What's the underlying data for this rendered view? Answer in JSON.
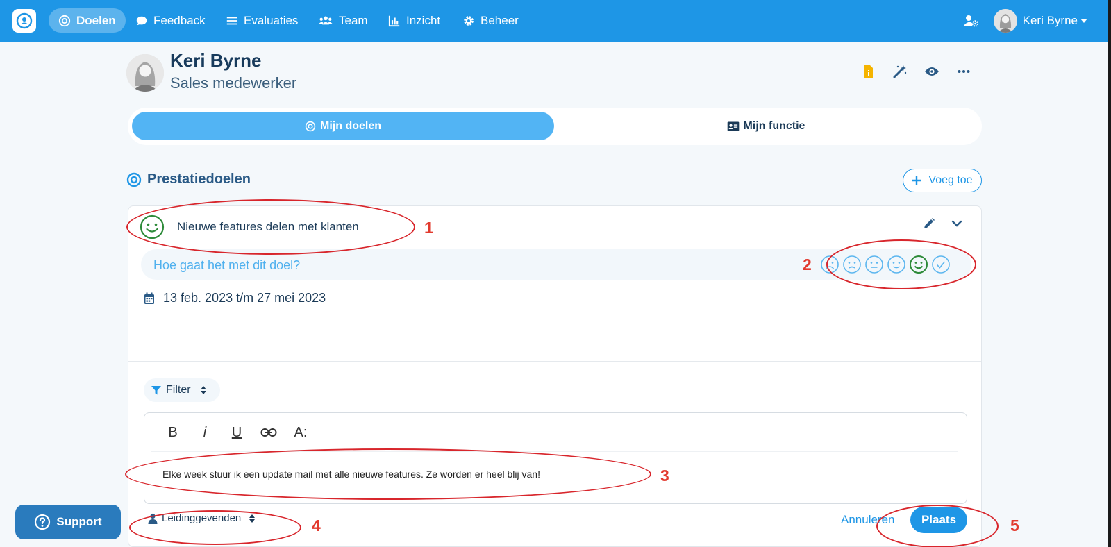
{
  "nav": {
    "items": [
      {
        "label": "Doelen",
        "icon": "target-icon",
        "active": true
      },
      {
        "label": "Feedback",
        "icon": "chat-icon"
      },
      {
        "label": "Evaluaties",
        "icon": "list-icon"
      },
      {
        "label": "Team",
        "icon": "users-icon"
      },
      {
        "label": "Inzicht",
        "icon": "chart-icon"
      },
      {
        "label": "Beheer",
        "icon": "gear-icon"
      }
    ],
    "user_name": "Keri Byrne"
  },
  "profile": {
    "name": "Keri Byrne",
    "role": "Sales medewerker"
  },
  "tabs": [
    {
      "label": "Mijn doelen",
      "icon": "target-icon",
      "active": true
    },
    {
      "label": "Mijn functie",
      "icon": "id-card-icon"
    }
  ],
  "section": {
    "title": "Prestatiedoelen",
    "add_label": "Voeg toe"
  },
  "goal": {
    "title": "Nieuwe features delen met klanten",
    "question": "Hoe gaat het met dit doel?",
    "date_range": "13 feb. 2023 t/m 27 mei 2023",
    "mood_selected": 5,
    "mood_levels": [
      "very-sad-face-icon",
      "sad-face-icon",
      "neutral-face-icon",
      "happy-face-icon",
      "very-happy-face-icon",
      "check-icon"
    ]
  },
  "comment": {
    "filter_label": "Filter",
    "toolbar": [
      "B",
      "i",
      "U",
      "link",
      "A:"
    ],
    "text": "Elke week stuur ik een update mail met alle nieuwe features. Ze worden er heel blij van!",
    "visibility_label": "Leidinggevenden",
    "cancel_label": "Annuleren",
    "post_label": "Plaats"
  },
  "support": {
    "label": "Support"
  },
  "annotations": [
    "1",
    "2",
    "3",
    "4",
    "5"
  ],
  "colors": {
    "primary": "#1e96e6",
    "tab_active": "#52b4f4",
    "annotation": "#d8262c",
    "mood_green": "#2e8b3a"
  }
}
